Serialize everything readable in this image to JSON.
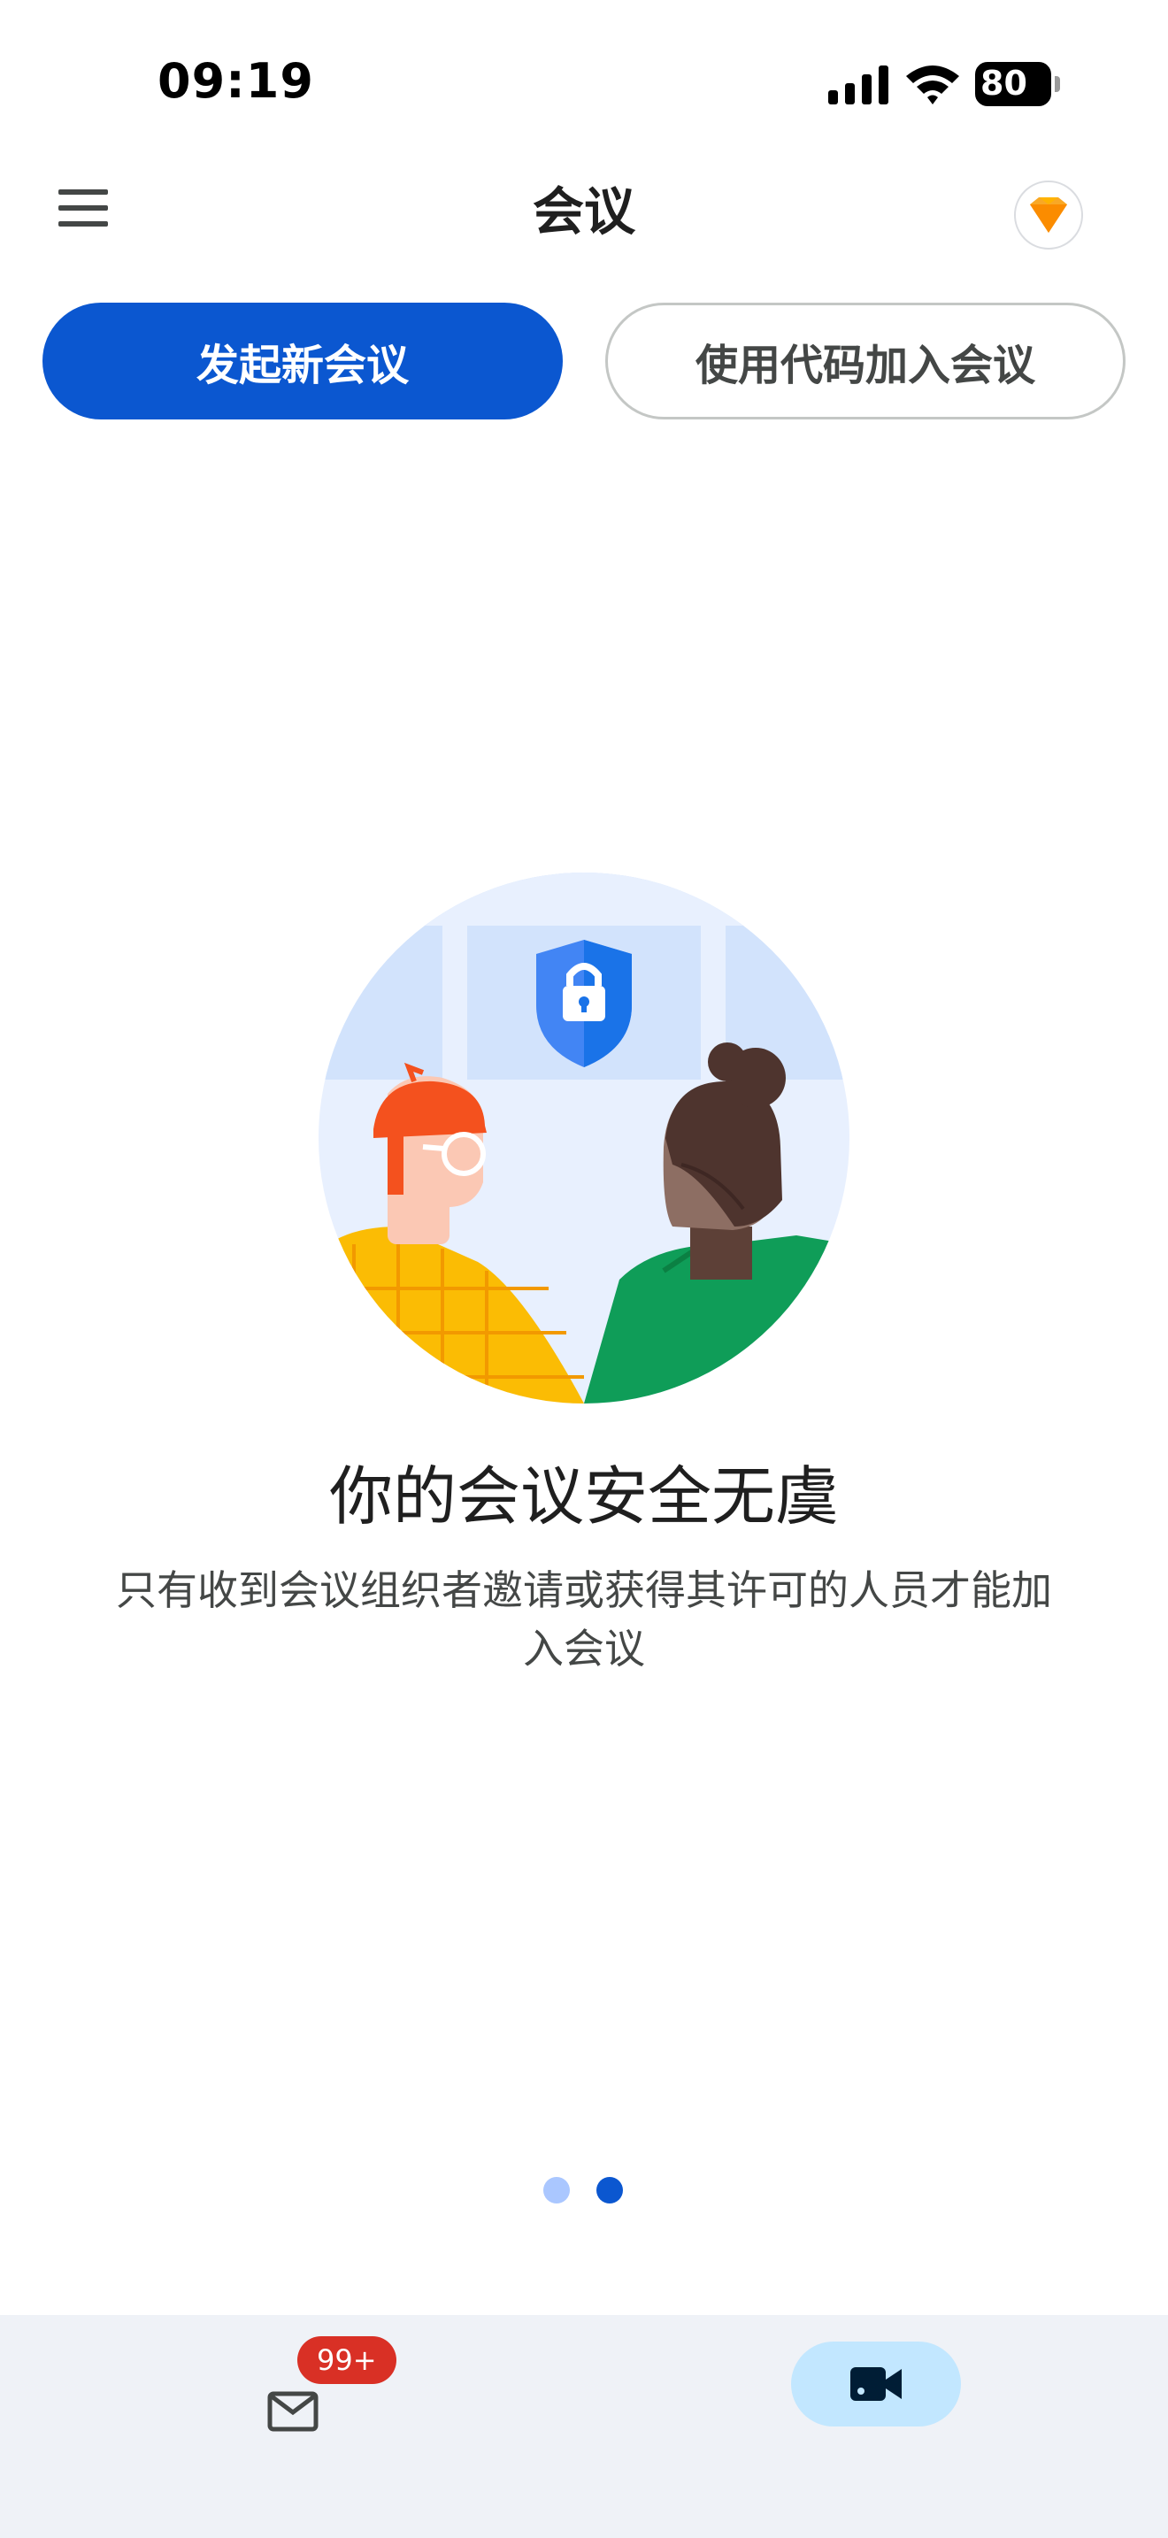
{
  "status_bar": {
    "time": "09:19",
    "battery_level": "80",
    "icons": [
      "signal-icon",
      "wifi-icon",
      "battery-charging-icon"
    ]
  },
  "app_bar": {
    "title": "会议",
    "menu_icon": "hamburger-menu-icon",
    "avatar_icon": "account-avatar-icon"
  },
  "actions": {
    "new_meeting_label": "发起新会议",
    "join_with_code_label": "使用代码加入会议"
  },
  "onboarding": {
    "illustration": "secure-meeting-illustration",
    "headline": "你的会议安全无虞",
    "body": "只有收到会议组织者邀请或获得其许可的人员才能加入会议",
    "page_count": 2,
    "current_page": 2
  },
  "bottom_nav": {
    "mail_icon": "mail-icon",
    "mail_badge": "99+",
    "meet_icon": "video-camera-icon",
    "active_tab": "meet"
  },
  "colors": {
    "primary": "#0b57d0",
    "badge": "#d93025",
    "nav_background": "#eff2f7",
    "active_pill": "#c2e7ff"
  }
}
